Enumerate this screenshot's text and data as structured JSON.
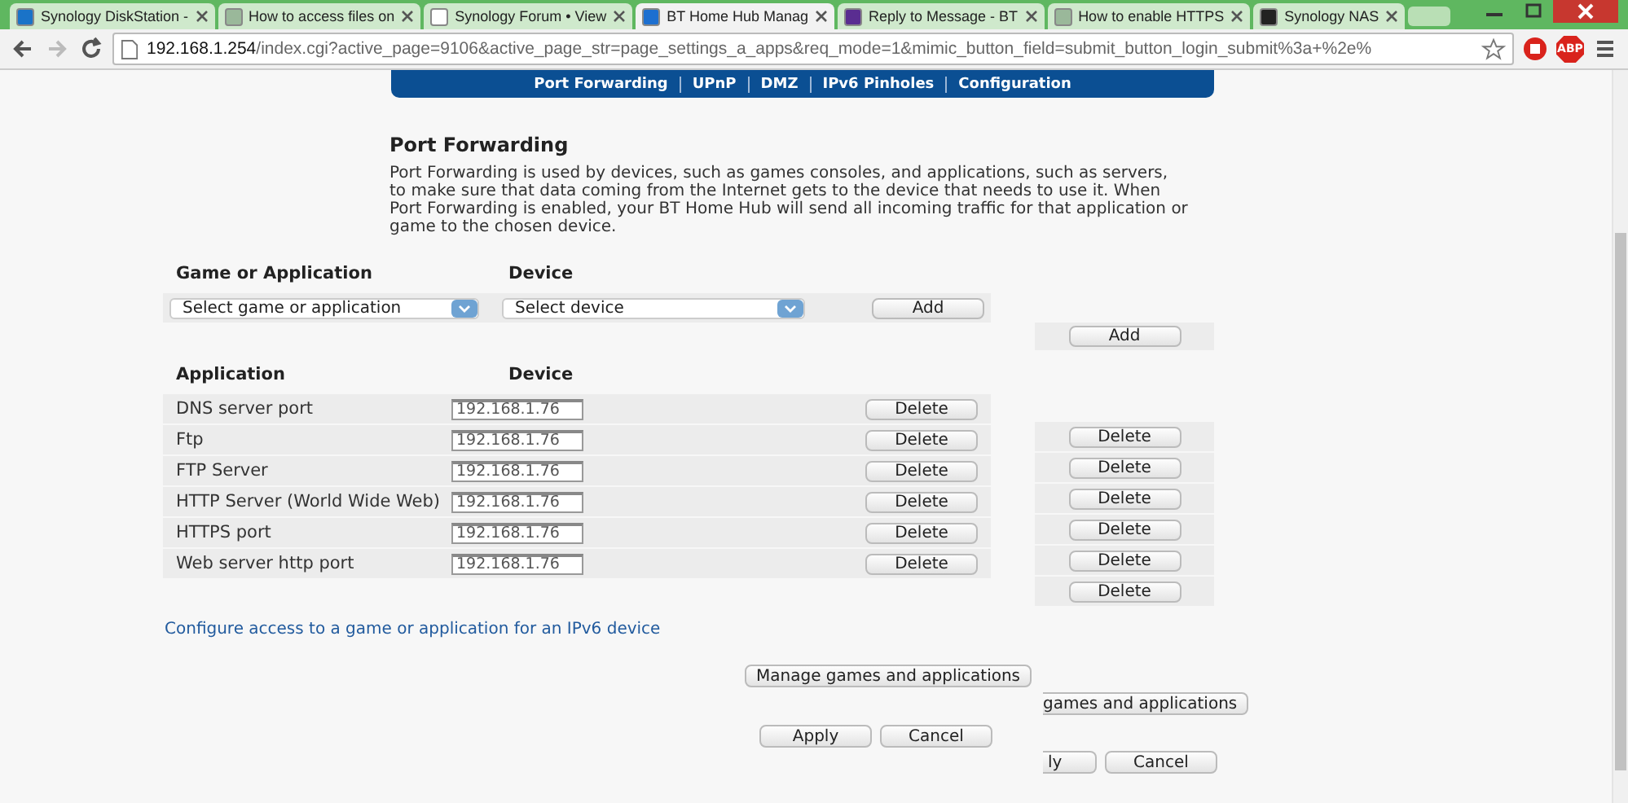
{
  "browser": {
    "tabs": [
      {
        "title": "Synology DiskStation -",
        "color": "#1a73c8",
        "selected": false
      },
      {
        "title": "How to access files on",
        "color": "#9ab89a",
        "selected": false
      },
      {
        "title": "Synology Forum • View",
        "color": "#ffffff",
        "selected": false
      },
      {
        "title": "BT Home Hub Manag",
        "color": "#1d6fd0",
        "selected": true
      },
      {
        "title": "Reply to Message - BT",
        "color": "#5a2d91",
        "selected": false
      },
      {
        "title": "How to enable HTTPS",
        "color": "#9ab89a",
        "selected": false
      },
      {
        "title": "Synology NAS",
        "color": "#222222",
        "selected": false
      }
    ],
    "url_host": "192.168.1.254",
    "url_path": "/index.cgi?active_page=9106&active_page_str=page_settings_a_apps&req_mode=1&mimic_button_field=submit_button_login_submit%3a+%2e%",
    "extensions": [
      {
        "kind": "stop"
      },
      {
        "kind": "abp",
        "label": "ABP"
      }
    ]
  },
  "nav": [
    "Port Forwarding",
    "UPnP",
    "DMZ",
    "IPv6 Pinholes",
    "Configuration"
  ],
  "heading": "Port Forwarding",
  "intro": "Port Forwarding is used by devices, such as games consoles, and applications, such as servers, to make sure that data coming from the Internet gets to the device that needs to use it. When Port Forwarding is enabled, your BT Home Hub will send all incoming traffic for that application or game to the chosen device.",
  "add_form": {
    "columns": [
      "Game or Application",
      "Device"
    ],
    "game_select": "Select game or application",
    "device_select": "Select device",
    "add_button": "Add",
    "ghost_add_button": "Add"
  },
  "table": {
    "columns": [
      "Application",
      "Device"
    ],
    "rows": [
      {
        "application": "DNS server port",
        "device": "192.168.1.76",
        "action": "Delete"
      },
      {
        "application": "Ftp",
        "device": "192.168.1.76",
        "action": "Delete"
      },
      {
        "application": "FTP Server",
        "device": "192.168.1.76",
        "action": "Delete"
      },
      {
        "application": "HTTP Server (World Wide Web)",
        "device": "192.168.1.76",
        "action": "Delete"
      },
      {
        "application": "HTTPS port",
        "device": "192.168.1.76",
        "action": "Delete"
      },
      {
        "application": "Web server http port",
        "device": "192.168.1.76",
        "action": "Delete"
      }
    ],
    "ghost_actions": [
      "Delete",
      "Delete",
      "Delete",
      "Delete",
      "Delete",
      "Delete"
    ]
  },
  "ipv6_link": "Configure access to a game or application for an IPv6 device",
  "manage_button": "Manage games and applications",
  "ghost_manage_button": "games and applications",
  "apply_button": "Apply",
  "cancel_button": "Cancel",
  "ghost_apply_button": "ly",
  "ghost_cancel_button": "Cancel"
}
